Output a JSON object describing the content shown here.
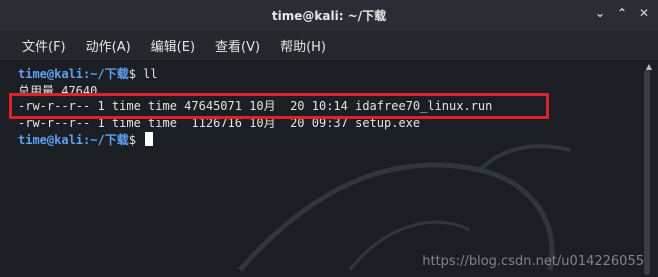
{
  "window": {
    "title": "time@kali: ~/下载"
  },
  "controls": {
    "minimize": "⌄",
    "maximize": "⌃",
    "close": "✕"
  },
  "menu": {
    "items": [
      "文件(F)",
      "动作(A)",
      "编辑(E)",
      "查看(V)",
      "帮助(H)"
    ]
  },
  "terminal": {
    "prompt_user": "time@kali",
    "prompt_path": ":~/下载",
    "prompt_suffix": "$ ",
    "command": "ll",
    "total": "总用量 47640",
    "rows": [
      "-rw-r--r-- 1 time time 47645071 10月  20 10:14 idafree70_linux.run",
      "-rw-r--r-- 1 time time  1126716 10月  20 09:37 setup.exe"
    ]
  },
  "watermark": {
    "url": "https://blog.csdn.net/u014226055"
  },
  "colors": {
    "highlight": "#d9242c",
    "prompt": "#5ea3f3"
  }
}
